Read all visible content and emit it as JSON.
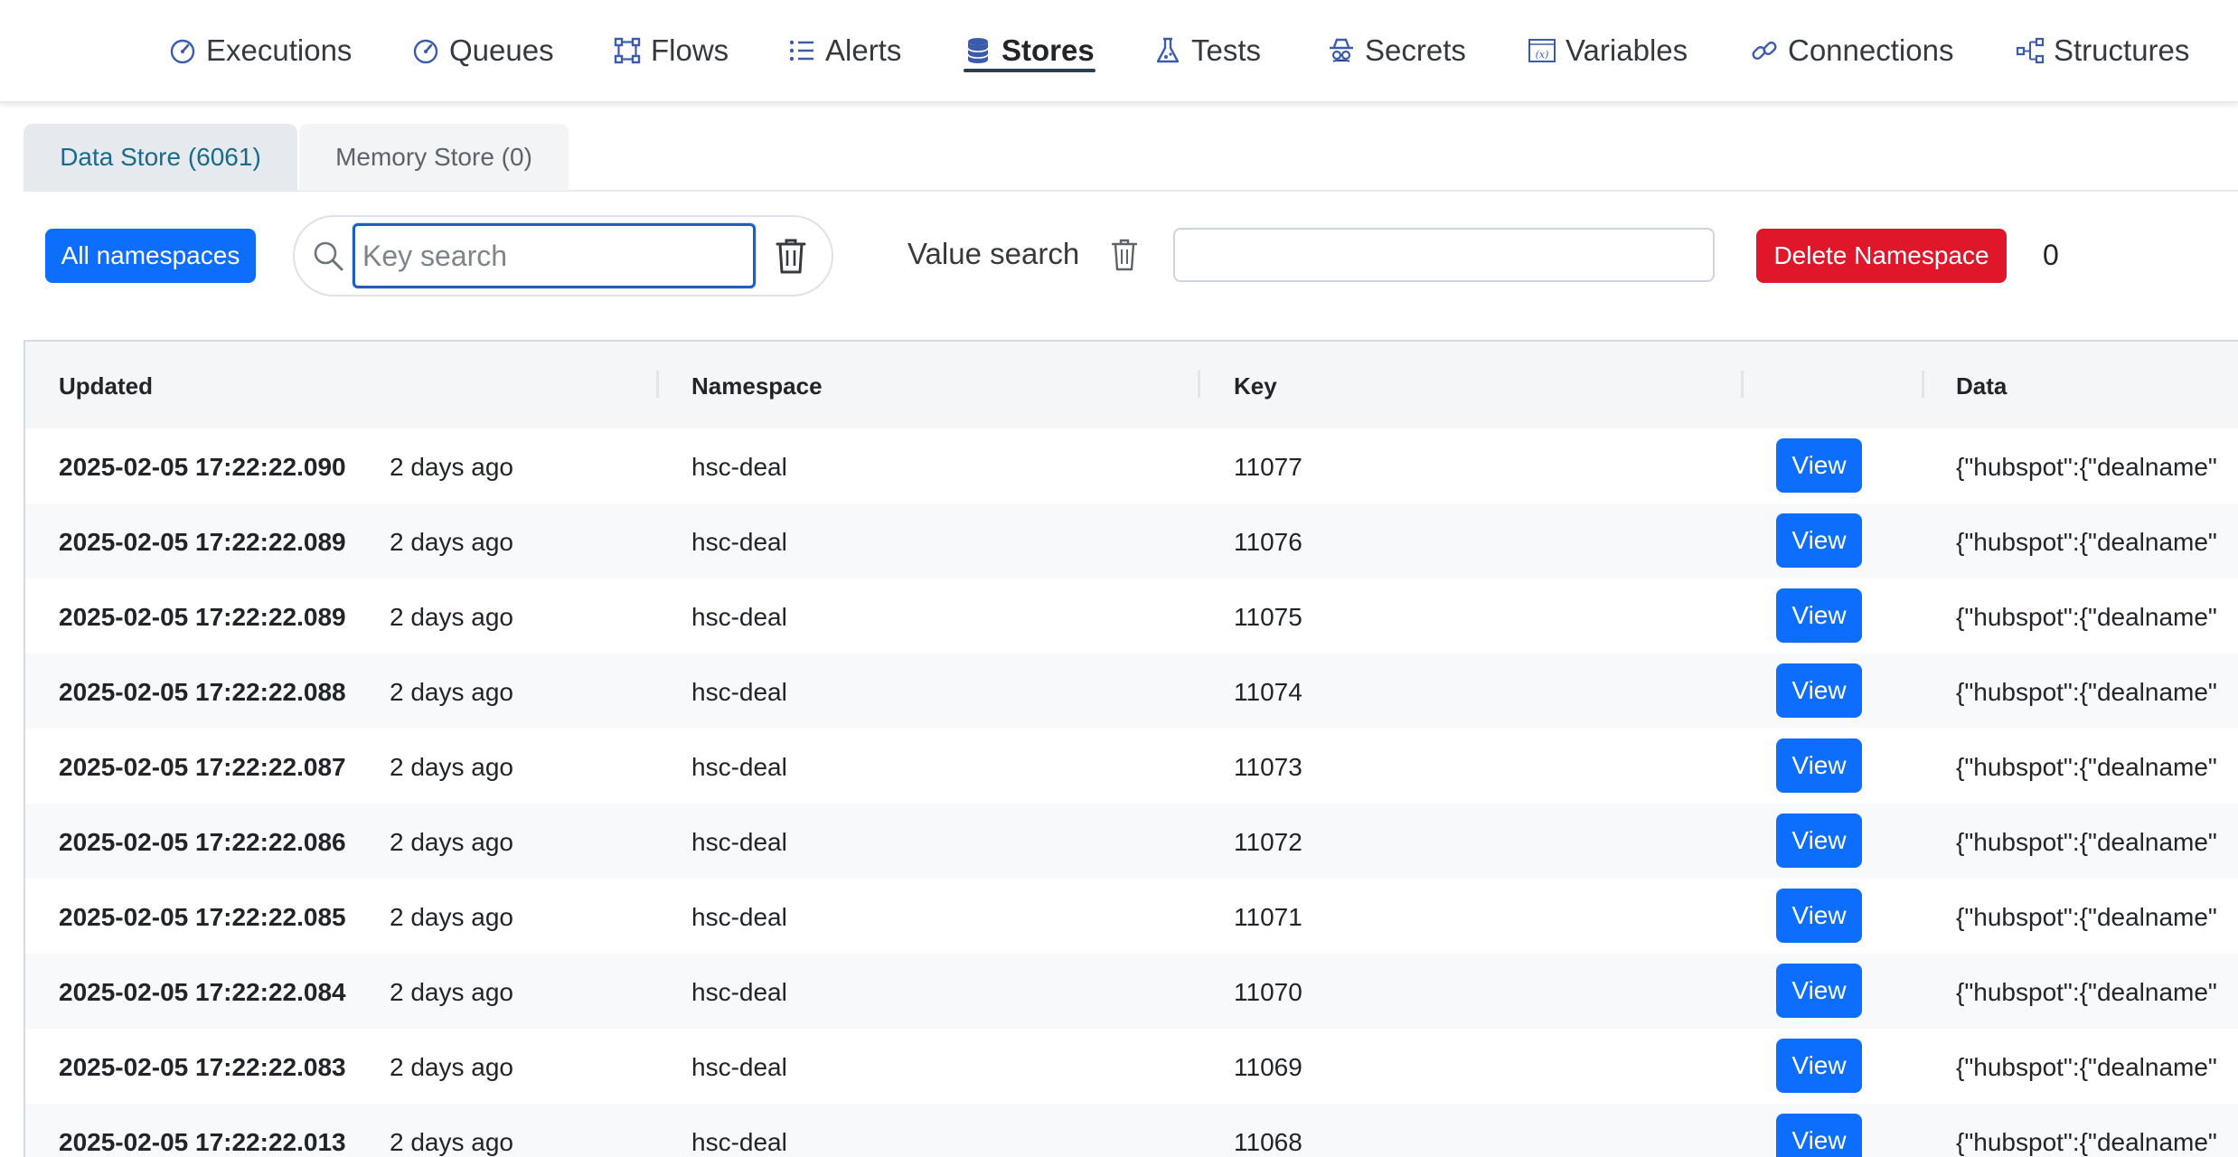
{
  "nav": {
    "items": [
      {
        "label": "Executions",
        "icon": "gauge-icon"
      },
      {
        "label": "Queues",
        "icon": "gauge-icon"
      },
      {
        "label": "Flows",
        "icon": "flow-icon"
      },
      {
        "label": "Alerts",
        "icon": "list-icon"
      },
      {
        "label": "Stores",
        "icon": "database-icon"
      },
      {
        "label": "Tests",
        "icon": "flask-icon"
      },
      {
        "label": "Secrets",
        "icon": "spy-icon"
      },
      {
        "label": "Variables",
        "icon": "variable-icon"
      },
      {
        "label": "Connections",
        "icon": "link-icon"
      },
      {
        "label": "Structures",
        "icon": "sitemap-icon"
      }
    ],
    "active": "Stores"
  },
  "tabs": [
    {
      "label": "Data Store (6061)",
      "active": true
    },
    {
      "label": "Memory Store (0)",
      "active": false
    }
  ],
  "toolbar": {
    "all_namespaces": "All namespaces",
    "key_search_placeholder": "Key search",
    "key_search_value": "",
    "value_search_label": "Value search",
    "value_search_value": "",
    "delete_namespace": "Delete Namespace",
    "count": "0"
  },
  "table": {
    "headers": [
      "Updated",
      "Namespace",
      "Key",
      "",
      "Data"
    ],
    "view_label": "View",
    "rows": [
      {
        "updated": "2025-02-05 17:22:22.090",
        "ago": "2 days ago",
        "namespace": "hsc-deal",
        "key": "11077",
        "data": "{\"hubspot\":{\"dealname\""
      },
      {
        "updated": "2025-02-05 17:22:22.089",
        "ago": "2 days ago",
        "namespace": "hsc-deal",
        "key": "11076",
        "data": "{\"hubspot\":{\"dealname\""
      },
      {
        "updated": "2025-02-05 17:22:22.089",
        "ago": "2 days ago",
        "namespace": "hsc-deal",
        "key": "11075",
        "data": "{\"hubspot\":{\"dealname\""
      },
      {
        "updated": "2025-02-05 17:22:22.088",
        "ago": "2 days ago",
        "namespace": "hsc-deal",
        "key": "11074",
        "data": "{\"hubspot\":{\"dealname\""
      },
      {
        "updated": "2025-02-05 17:22:22.087",
        "ago": "2 days ago",
        "namespace": "hsc-deal",
        "key": "11073",
        "data": "{\"hubspot\":{\"dealname\""
      },
      {
        "updated": "2025-02-05 17:22:22.086",
        "ago": "2 days ago",
        "namespace": "hsc-deal",
        "key": "11072",
        "data": "{\"hubspot\":{\"dealname\""
      },
      {
        "updated": "2025-02-05 17:22:22.085",
        "ago": "2 days ago",
        "namespace": "hsc-deal",
        "key": "11071",
        "data": "{\"hubspot\":{\"dealname\""
      },
      {
        "updated": "2025-02-05 17:22:22.084",
        "ago": "2 days ago",
        "namespace": "hsc-deal",
        "key": "11070",
        "data": "{\"hubspot\":{\"dealname\""
      },
      {
        "updated": "2025-02-05 17:22:22.083",
        "ago": "2 days ago",
        "namespace": "hsc-deal",
        "key": "11069",
        "data": "{\"hubspot\":{\"dealname\""
      },
      {
        "updated": "2025-02-05 17:22:22.013",
        "ago": "2 days ago",
        "namespace": "hsc-deal",
        "key": "11068",
        "data": "{\"hubspot\":{\"dealname\""
      }
    ]
  },
  "colors": {
    "primary": "#0d6efd",
    "danger": "#e0162b",
    "nav_icon": "#3b5cad",
    "active_tab_text": "#1a6a8c"
  }
}
